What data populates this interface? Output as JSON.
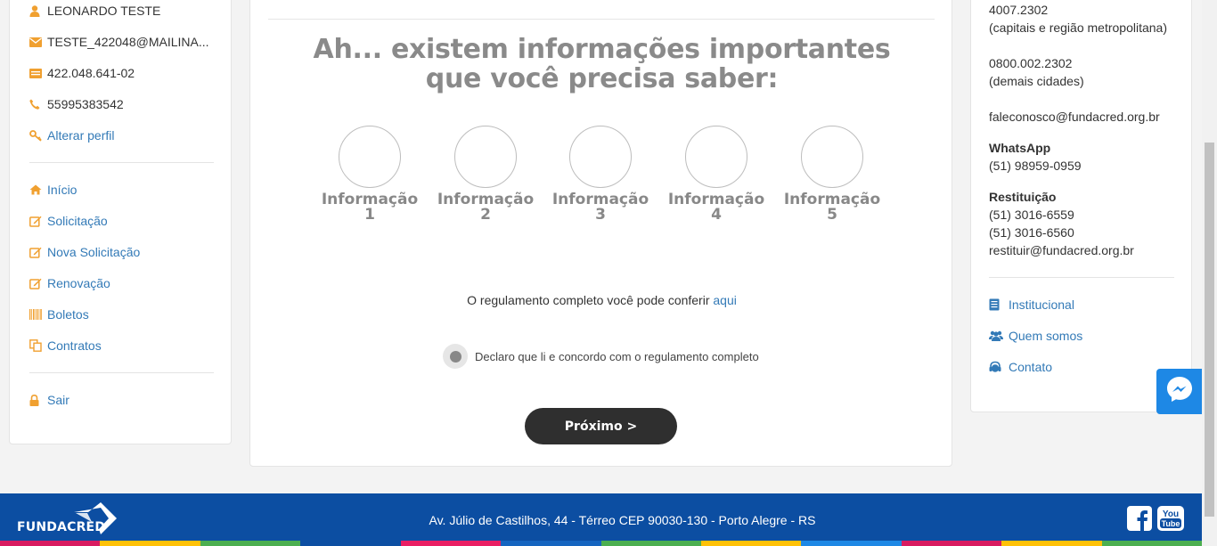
{
  "profile": {
    "name": "LEONARDO TESTE",
    "email": "TESTE_422048@MAILINA...",
    "cpf": "422.048.641-02",
    "phone": "55995383542",
    "edit_profile": "Alterar perfil"
  },
  "nav": {
    "items": [
      {
        "label": "Início",
        "icon": "home-icon"
      },
      {
        "label": "Solicitação",
        "icon": "edit-icon"
      },
      {
        "label": "Nova Solicitação",
        "icon": "edit-icon"
      },
      {
        "label": "Renovação",
        "icon": "edit-icon"
      },
      {
        "label": "Boletos",
        "icon": "barcode-icon"
      },
      {
        "label": "Contratos",
        "icon": "copy-icon"
      }
    ],
    "logout": "Sair"
  },
  "main": {
    "heading_line1": "Ah... existem informações importantes",
    "heading_line2": "que você precisa saber:",
    "info_items": [
      {
        "label": "Informação",
        "num": "1"
      },
      {
        "label": "Informação",
        "num": "2"
      },
      {
        "label": "Informação",
        "num": "3"
      },
      {
        "label": "Informação",
        "num": "4"
      },
      {
        "label": "Informação",
        "num": "5"
      }
    ],
    "regulation_text": "O regulamento completo você pode conferir",
    "regulation_link": "aqui",
    "declare_text": "Declaro que li e concordo com o regulamento completo",
    "next_button": "Próximo >"
  },
  "contact": {
    "phone1": "4007.2302",
    "phone1_note": "(capitais e região metropolitana)",
    "phone2": "0800.002.2302",
    "phone2_note": "(demais cidades)",
    "email": "faleconosco@fundacred.org.br",
    "whatsapp_title": "WhatsApp",
    "whatsapp_number": "(51) 98959-0959",
    "restituicao_title": "Restituição",
    "restituicao_phone1": "(51) 3016-6559",
    "restituicao_phone2": "(51) 3016-6560",
    "restituicao_email": "restituir@fundacred.org.br",
    "links": [
      {
        "label": "Institucional",
        "icon": "book-icon"
      },
      {
        "label": "Quem somos",
        "icon": "users-icon"
      },
      {
        "label": "Contato",
        "icon": "headset-icon"
      }
    ]
  },
  "footer": {
    "brand": "FUNDACRED",
    "address": "Av. Júlio de Castilhos, 44 - Térreo CEP 90030-130 - Porto Alegre - RS"
  },
  "colors": {
    "accent_orange": "#f0a030",
    "link_blue": "#337ab7",
    "footer_blue": "#0c4ea2",
    "button_dark": "#2f2f2f"
  }
}
